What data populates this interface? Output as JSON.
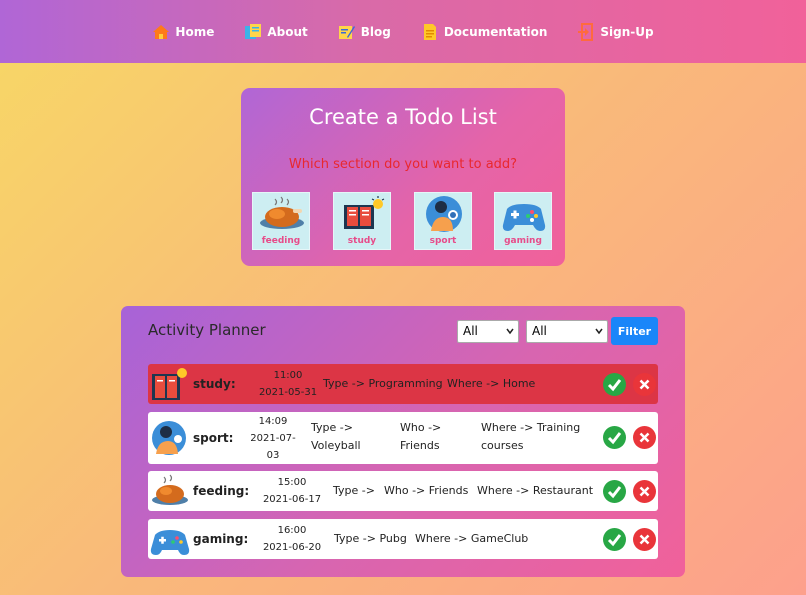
{
  "nav": {
    "items": [
      {
        "label": "Home",
        "icon": "home-icon"
      },
      {
        "label": "About",
        "icon": "about-icon"
      },
      {
        "label": "Blog",
        "icon": "blog-icon"
      },
      {
        "label": "Documentation",
        "icon": "documentation-icon"
      },
      {
        "label": "Sign-Up",
        "icon": "sign-up-icon"
      }
    ]
  },
  "create": {
    "title": "Create a Todo List",
    "subtitle": "Which section do you want to add?",
    "sections": [
      {
        "label": "feeding",
        "icon": "roast-chicken-icon"
      },
      {
        "label": "study",
        "icon": "book-icon"
      },
      {
        "label": "sport",
        "icon": "athlete-icon"
      },
      {
        "label": "gaming",
        "icon": "gamepad-icon"
      }
    ]
  },
  "planner": {
    "title": "Activity Planner",
    "filter1": "All",
    "filter2": "All",
    "filter_label": "Filter",
    "rows": [
      {
        "category": "study:",
        "time": "11:00",
        "date": "2021-05-31",
        "type": "Type -> Programming",
        "who": "",
        "where": "Where -> Home",
        "highlight": true
      },
      {
        "category": "sport:",
        "time": "14:09",
        "date": "2021-07-03",
        "type": "Type -> Voleyball",
        "who": "Who -> Friends",
        "where": "Where -> Training courses",
        "highlight": false
      },
      {
        "category": "feeding:",
        "time": "15:00",
        "date": "2021-06-17",
        "type": "Type ->",
        "who": "Who -> Friends",
        "where": "Where -> Restaurant",
        "highlight": false
      },
      {
        "category": "gaming:",
        "time": "16:00",
        "date": "2021-06-20",
        "type": "Type -> Pubg",
        "who": "",
        "where": "Where -> GameClub",
        "highlight": false
      }
    ]
  },
  "colors": {
    "nav_start": "#b066d6",
    "nav_end": "#f1619a",
    "highlight_row": "#dc3545",
    "filter_button": "#1a86f9",
    "done": "#28a745",
    "delete": "#e9353a"
  }
}
